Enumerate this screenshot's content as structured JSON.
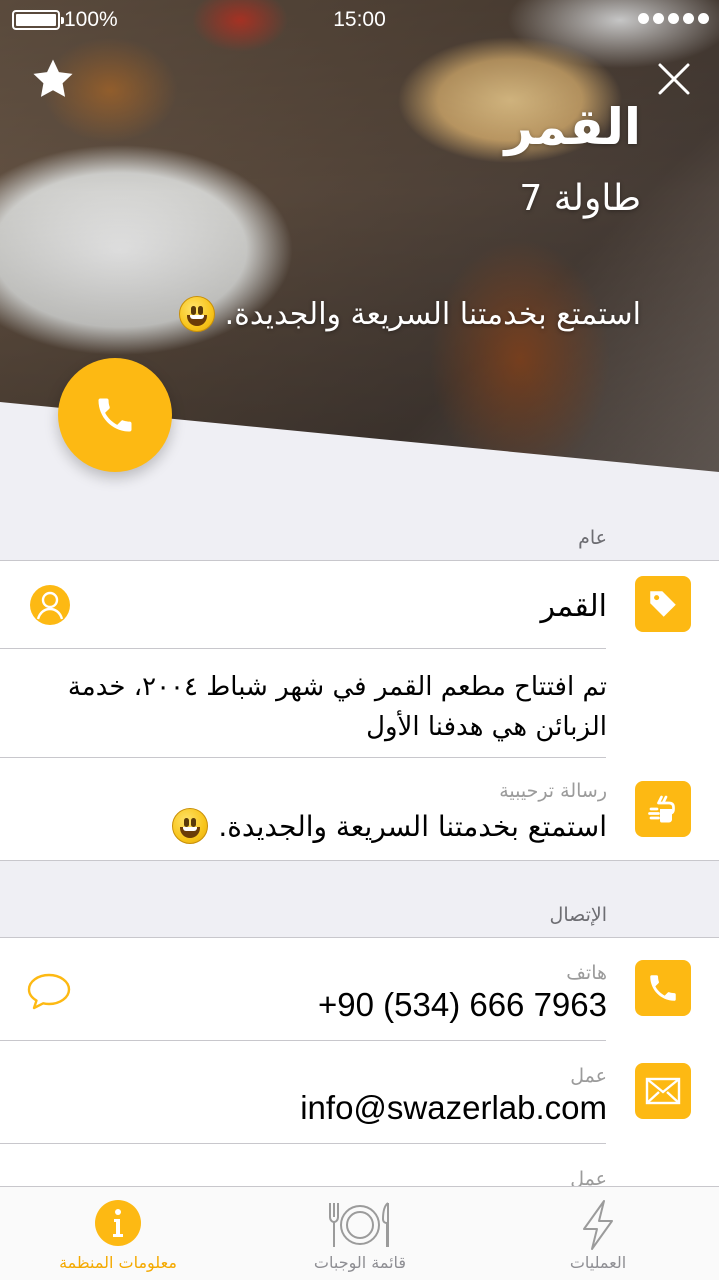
{
  "status_bar": {
    "battery": "100%",
    "time": "15:00"
  },
  "hero": {
    "title": "القمر",
    "subtitle": "طاولة 7",
    "welcome": "استمتع بخدمتنا السريعة والجديدة."
  },
  "general": {
    "header": "عام",
    "name": "القمر",
    "description": "تم افتتاح مطعم القمر في شهر شباط ٢٠٠٤، خدمة الزبائن هي هدفنا الأول",
    "welcome_label": "رسالة ترحيبية",
    "welcome_value": "استمتع بخدمتنا السريعة والجديدة."
  },
  "contact": {
    "header": "الإتصال",
    "phone_label": "هاتف",
    "phone_value": "+90 (534) 666 7963",
    "email_label": "عمل",
    "email_value": "info@swazerlab.com",
    "extra_label": "عمل"
  },
  "tabs": [
    {
      "label": "معلومات المنظمة",
      "icon": "info-icon",
      "active": true
    },
    {
      "label": "قائمة الوجبات",
      "icon": "plate-cutlery-icon",
      "active": false
    },
    {
      "label": "العمليات",
      "icon": "lightning-icon",
      "active": false
    }
  ],
  "colors": {
    "accent": "#fdb913",
    "background": "#efeff4",
    "active_tab": "#f4a900"
  }
}
